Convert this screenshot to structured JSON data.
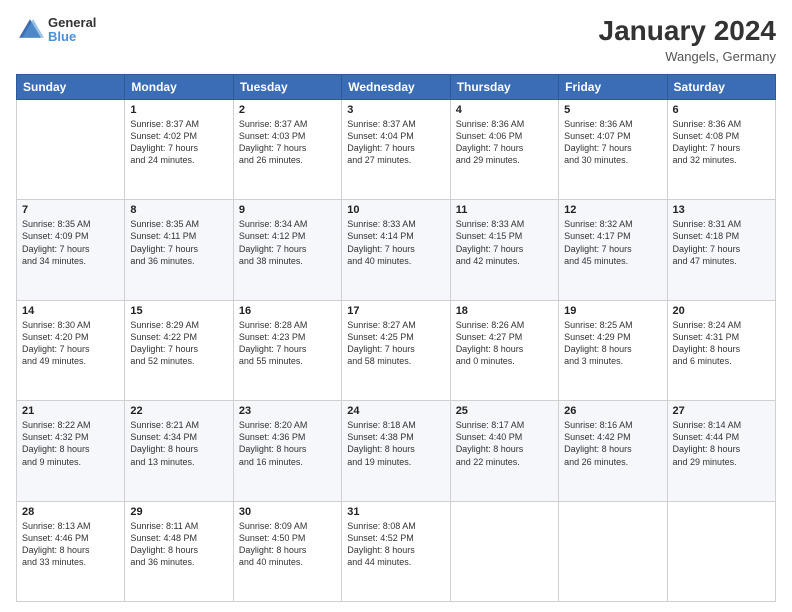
{
  "header": {
    "logo": {
      "line1": "General",
      "line2": "Blue"
    },
    "title": "January 2024",
    "location": "Wangels, Germany"
  },
  "weekdays": [
    "Sunday",
    "Monday",
    "Tuesday",
    "Wednesday",
    "Thursday",
    "Friday",
    "Saturday"
  ],
  "weeks": [
    [
      {
        "day": "",
        "info": ""
      },
      {
        "day": "1",
        "info": "Sunrise: 8:37 AM\nSunset: 4:02 PM\nDaylight: 7 hours\nand 24 minutes."
      },
      {
        "day": "2",
        "info": "Sunrise: 8:37 AM\nSunset: 4:03 PM\nDaylight: 7 hours\nand 26 minutes."
      },
      {
        "day": "3",
        "info": "Sunrise: 8:37 AM\nSunset: 4:04 PM\nDaylight: 7 hours\nand 27 minutes."
      },
      {
        "day": "4",
        "info": "Sunrise: 8:36 AM\nSunset: 4:06 PM\nDaylight: 7 hours\nand 29 minutes."
      },
      {
        "day": "5",
        "info": "Sunrise: 8:36 AM\nSunset: 4:07 PM\nDaylight: 7 hours\nand 30 minutes."
      },
      {
        "day": "6",
        "info": "Sunrise: 8:36 AM\nSunset: 4:08 PM\nDaylight: 7 hours\nand 32 minutes."
      }
    ],
    [
      {
        "day": "7",
        "info": "Sunrise: 8:35 AM\nSunset: 4:09 PM\nDaylight: 7 hours\nand 34 minutes."
      },
      {
        "day": "8",
        "info": "Sunrise: 8:35 AM\nSunset: 4:11 PM\nDaylight: 7 hours\nand 36 minutes."
      },
      {
        "day": "9",
        "info": "Sunrise: 8:34 AM\nSunset: 4:12 PM\nDaylight: 7 hours\nand 38 minutes."
      },
      {
        "day": "10",
        "info": "Sunrise: 8:33 AM\nSunset: 4:14 PM\nDaylight: 7 hours\nand 40 minutes."
      },
      {
        "day": "11",
        "info": "Sunrise: 8:33 AM\nSunset: 4:15 PM\nDaylight: 7 hours\nand 42 minutes."
      },
      {
        "day": "12",
        "info": "Sunrise: 8:32 AM\nSunset: 4:17 PM\nDaylight: 7 hours\nand 45 minutes."
      },
      {
        "day": "13",
        "info": "Sunrise: 8:31 AM\nSunset: 4:18 PM\nDaylight: 7 hours\nand 47 minutes."
      }
    ],
    [
      {
        "day": "14",
        "info": "Sunrise: 8:30 AM\nSunset: 4:20 PM\nDaylight: 7 hours\nand 49 minutes."
      },
      {
        "day": "15",
        "info": "Sunrise: 8:29 AM\nSunset: 4:22 PM\nDaylight: 7 hours\nand 52 minutes."
      },
      {
        "day": "16",
        "info": "Sunrise: 8:28 AM\nSunset: 4:23 PM\nDaylight: 7 hours\nand 55 minutes."
      },
      {
        "day": "17",
        "info": "Sunrise: 8:27 AM\nSunset: 4:25 PM\nDaylight: 7 hours\nand 58 minutes."
      },
      {
        "day": "18",
        "info": "Sunrise: 8:26 AM\nSunset: 4:27 PM\nDaylight: 8 hours\nand 0 minutes."
      },
      {
        "day": "19",
        "info": "Sunrise: 8:25 AM\nSunset: 4:29 PM\nDaylight: 8 hours\nand 3 minutes."
      },
      {
        "day": "20",
        "info": "Sunrise: 8:24 AM\nSunset: 4:31 PM\nDaylight: 8 hours\nand 6 minutes."
      }
    ],
    [
      {
        "day": "21",
        "info": "Sunrise: 8:22 AM\nSunset: 4:32 PM\nDaylight: 8 hours\nand 9 minutes."
      },
      {
        "day": "22",
        "info": "Sunrise: 8:21 AM\nSunset: 4:34 PM\nDaylight: 8 hours\nand 13 minutes."
      },
      {
        "day": "23",
        "info": "Sunrise: 8:20 AM\nSunset: 4:36 PM\nDaylight: 8 hours\nand 16 minutes."
      },
      {
        "day": "24",
        "info": "Sunrise: 8:18 AM\nSunset: 4:38 PM\nDaylight: 8 hours\nand 19 minutes."
      },
      {
        "day": "25",
        "info": "Sunrise: 8:17 AM\nSunset: 4:40 PM\nDaylight: 8 hours\nand 22 minutes."
      },
      {
        "day": "26",
        "info": "Sunrise: 8:16 AM\nSunset: 4:42 PM\nDaylight: 8 hours\nand 26 minutes."
      },
      {
        "day": "27",
        "info": "Sunrise: 8:14 AM\nSunset: 4:44 PM\nDaylight: 8 hours\nand 29 minutes."
      }
    ],
    [
      {
        "day": "28",
        "info": "Sunrise: 8:13 AM\nSunset: 4:46 PM\nDaylight: 8 hours\nand 33 minutes."
      },
      {
        "day": "29",
        "info": "Sunrise: 8:11 AM\nSunset: 4:48 PM\nDaylight: 8 hours\nand 36 minutes."
      },
      {
        "day": "30",
        "info": "Sunrise: 8:09 AM\nSunset: 4:50 PM\nDaylight: 8 hours\nand 40 minutes."
      },
      {
        "day": "31",
        "info": "Sunrise: 8:08 AM\nSunset: 4:52 PM\nDaylight: 8 hours\nand 44 minutes."
      },
      {
        "day": "",
        "info": ""
      },
      {
        "day": "",
        "info": ""
      },
      {
        "day": "",
        "info": ""
      }
    ]
  ]
}
